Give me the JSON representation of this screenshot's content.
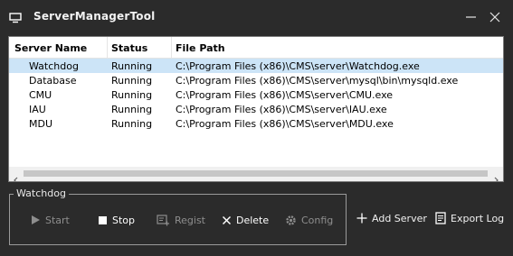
{
  "window": {
    "title": "ServerManagerTool"
  },
  "table": {
    "columns": [
      "Server Name",
      "Status",
      "File Path"
    ],
    "rows": [
      {
        "name": "Watchdog",
        "status": "Running",
        "path": "C:\\Program Files (x86)\\CMS\\server\\Watchdog.exe",
        "selected": true
      },
      {
        "name": "Database",
        "status": "Running",
        "path": "C:\\Program Files (x86)\\CMS\\server\\mysql\\bin\\mysqld.exe",
        "selected": false
      },
      {
        "name": "CMU",
        "status": "Running",
        "path": "C:\\Program Files (x86)\\CMS\\server\\CMU.exe",
        "selected": false
      },
      {
        "name": "IAU",
        "status": "Running",
        "path": "C:\\Program Files (x86)\\CMS\\server\\IAU.exe",
        "selected": false
      },
      {
        "name": "MDU",
        "status": "Running",
        "path": "C:\\Program Files (x86)\\CMS\\server\\MDU.exe",
        "selected": false
      }
    ]
  },
  "group": {
    "label": "Watchdog",
    "buttons": {
      "start": "Start",
      "stop": "Stop",
      "regist": "Regist",
      "delete": "Delete",
      "config": "Config"
    }
  },
  "actions": {
    "add_server": "Add Server",
    "export_log": "Export Log"
  },
  "colors": {
    "background": "#2b2b2b",
    "selected_row": "#cce4f7",
    "disabled_text": "#8e8e8e"
  },
  "icons": {
    "app": "monitor-icon",
    "minimize": "minimize-icon",
    "close": "close-icon",
    "start": "play-icon",
    "stop": "stop-icon",
    "regist": "register-icon",
    "delete": "x-icon",
    "config": "gear-icon",
    "add_server": "plus-icon",
    "export_log": "document-icon"
  }
}
